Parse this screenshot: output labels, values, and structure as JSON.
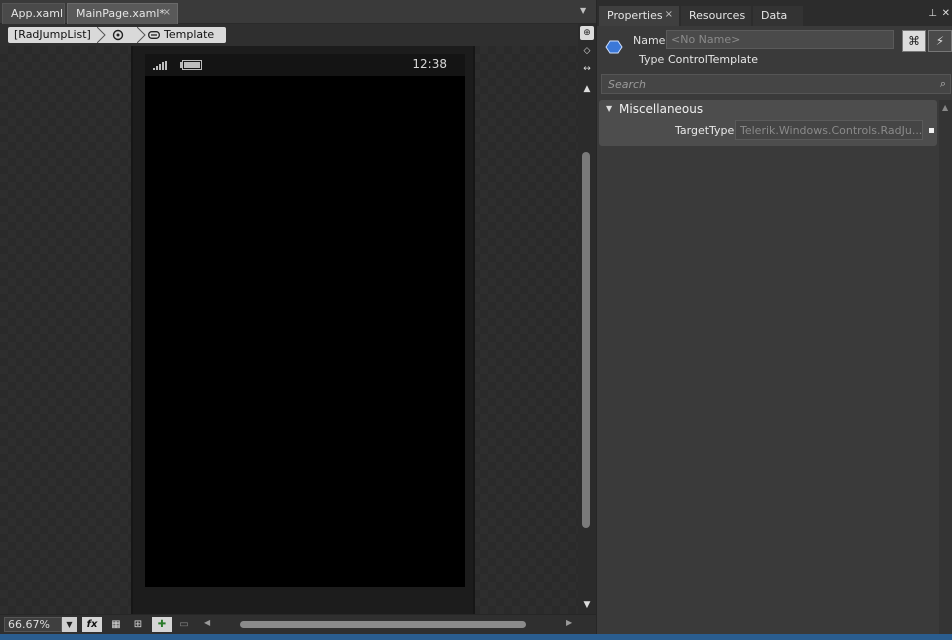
{
  "document_tabs": [
    {
      "label": "App.xaml"
    },
    {
      "label": "MainPage.xaml*",
      "close": "×"
    }
  ],
  "breadcrumb": {
    "item1": "[RadJumpList]",
    "item2_icon": "template-state-icon",
    "item3": "Template",
    "item3_icon": "template-link-icon"
  },
  "phone": {
    "clock": "12:38"
  },
  "bottom": {
    "zoom": "66.67%",
    "zoom_dropdown": "▼"
  },
  "properties_panel": {
    "tabs": [
      {
        "label": "Properties",
        "close": "×"
      },
      {
        "label": "Resources"
      },
      {
        "label": "Data"
      }
    ],
    "name_label": "Name",
    "name_placeholder": "<No Name>",
    "type_label": "Type",
    "type_value": "ControlTemplate",
    "search_placeholder": "Search",
    "section_title": "Miscellaneous",
    "target_type_label": "TargetType",
    "target_type_value": "Telerik.Windows.Controls.RadJu..."
  },
  "colors": {
    "status_line": "#2a5d8f",
    "canvas": "#2e2e2e",
    "phone_screen": "#000000"
  }
}
